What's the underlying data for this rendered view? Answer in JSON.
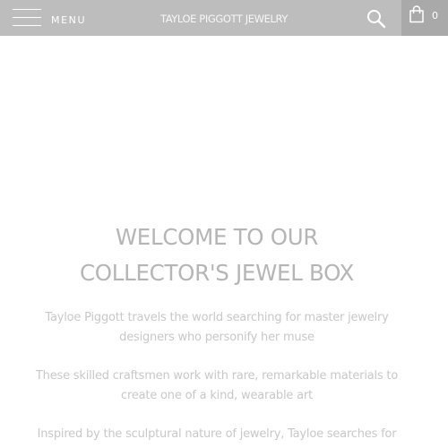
{
  "header": {
    "menu_label": "MENU",
    "brand": "TAYLOE PIGGOTT JEWELRY",
    "search_icon": "search-icon",
    "cart_icon": "shopping-bag-icon",
    "cart_count": "0",
    "bar_color": "#bdbdbd",
    "cart_bg_color": "#a9a9a9"
  },
  "main": {
    "heading_line1": "WELCOME TO OUR",
    "heading_line2": "COLLECTOR'S JEWEL BOX",
    "paragraphs": [
      {
        "line1": "Tayloe Piggott travels the world searching for master jewelry",
        "line2": "designers who personify her muse"
      },
      {
        "line1": "These skilled craftsmen work with rare, remarkable materials to",
        "line2": "create one of a kind, wearable art"
      },
      {
        "line1": "Inspired by the sculptural nature of jewelry, Tayloe searches for"
      }
    ],
    "heading_color": "#b5b5b5",
    "text_color": "#c8c8c8"
  }
}
